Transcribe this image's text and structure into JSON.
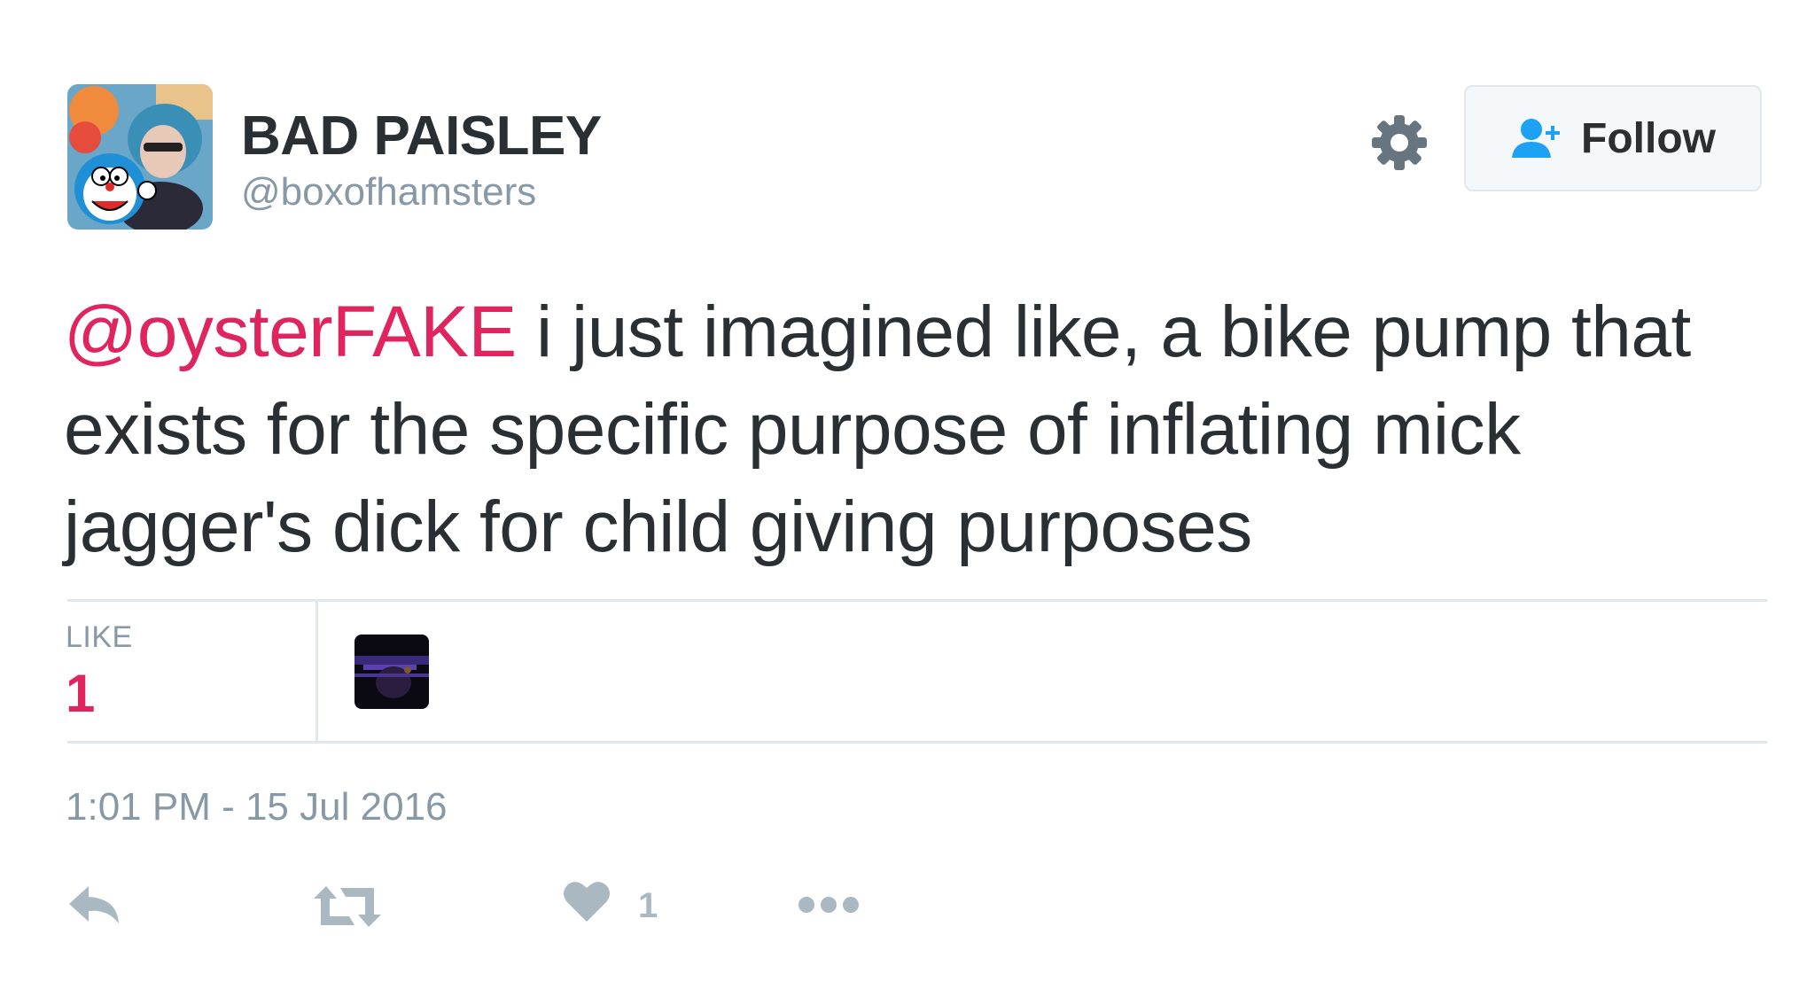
{
  "user": {
    "name": "BAD PAISLEY",
    "handle": "@boxofhamsters",
    "avatar_icon": "profile-photo"
  },
  "header": {
    "settings_icon": "gear-icon",
    "follow_label": "Follow",
    "follow_icon": "add-user-icon"
  },
  "tweet": {
    "mention": "@oysterFAKE",
    "text": " i just imagined like, a bike pump that exists for the specific purpose of inflating mick jagger's dick for child giving purposes"
  },
  "stats": {
    "like_label": "LIKE",
    "like_count": "1"
  },
  "timestamp": "1:01 PM - 15 Jul 2016",
  "actions": {
    "reply_icon": "reply-icon",
    "retweet_icon": "retweet-icon",
    "like_icon": "heart-icon",
    "like_count": "1",
    "more_icon": "more-dots-icon"
  },
  "colors": {
    "mention": "#e0245e",
    "like_count": "#e0245e",
    "muted": "#8899a6",
    "icon": "#aab8c2",
    "follow_icon": "#1da1f2",
    "text": "#292f33"
  }
}
